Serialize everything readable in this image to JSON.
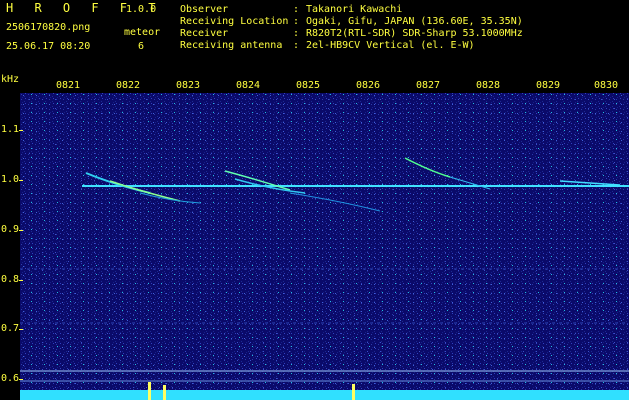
{
  "header": {
    "app_title": "H R O F F T",
    "version": "1.0.0",
    "filename": "2506170820.png",
    "datetime": "25.06.17 08:20",
    "meteor_label": "meteor",
    "meteor_count": "6",
    "fields": [
      {
        "label": "Observer",
        "sep": ":",
        "value": "Takanori Kawachi"
      },
      {
        "label": "Receiving Location",
        "sep": ":",
        "value": "Ogaki, Gifu, JAPAN (136.60E, 35.35N)"
      },
      {
        "label": "Receiver",
        "sep": ":",
        "value": "R820T2(RTL-SDR) SDR-Sharp 53.1000MHz"
      },
      {
        "label": "Receiving antenna",
        "sep": ":",
        "value": "2el-HB9CV Vertical (el. E-W)"
      }
    ]
  },
  "axis": {
    "unit": "kHz",
    "time_ticks": [
      "0821",
      "0822",
      "0823",
      "0824",
      "0825",
      "0826",
      "0827",
      "0828",
      "0829",
      "0830"
    ],
    "freq_ticks": [
      "1.1",
      "1.0",
      "0.9",
      "0.8",
      "0.7",
      "0.6"
    ]
  },
  "colors": {
    "background": "#0a0a6a",
    "text": "#3ff0ff",
    "axis": "#ffff40",
    "carrier": "#40e0ff"
  }
}
